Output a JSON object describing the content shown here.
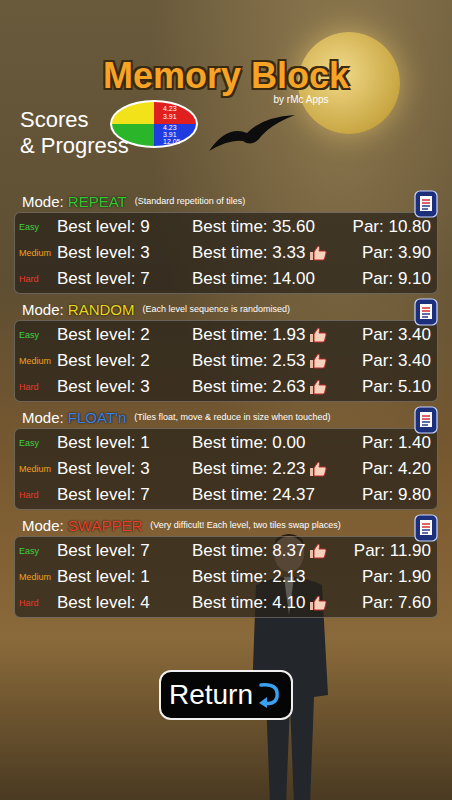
{
  "title": "Memory Block",
  "byline": "by rMc Apps",
  "heading": [
    "Scores",
    "& Progress"
  ],
  "pie": {
    "top": [
      "4.23",
      "3.91"
    ],
    "bottom": [
      "4.23",
      "3.91",
      "12.05"
    ]
  },
  "labels": {
    "mode": "Mode: ",
    "level": "Best level:",
    "time": "Best time:",
    "par": "Par:"
  },
  "modes": [
    {
      "name": "REPEAT",
      "color": "#2fcc2f",
      "description": "(Standard repetition of tiles)",
      "rows": [
        {
          "difficulty": "Easy",
          "color": "#3fd03f",
          "best_level": "9",
          "best_time": "35.60",
          "par": "10.80",
          "beat_par": false
        },
        {
          "difficulty": "Medium",
          "color": "#f0a020",
          "best_level": "3",
          "best_time": "3.33",
          "par": "3.90",
          "beat_par": true
        },
        {
          "difficulty": "Hard",
          "color": "#e83a2a",
          "best_level": "7",
          "best_time": "14.00",
          "par": "9.10",
          "beat_par": false
        }
      ]
    },
    {
      "name": "RANDOM",
      "color": "#ecd81a",
      "description": "(Each level sequence is randomised)",
      "rows": [
        {
          "difficulty": "Easy",
          "color": "#3fd03f",
          "best_level": "2",
          "best_time": "1.93",
          "par": "3.40",
          "beat_par": true
        },
        {
          "difficulty": "Medium",
          "color": "#f0a020",
          "best_level": "2",
          "best_time": "2.53",
          "par": "3.40",
          "beat_par": true
        },
        {
          "difficulty": "Hard",
          "color": "#e83a2a",
          "best_level": "3",
          "best_time": "2.63",
          "par": "5.10",
          "beat_par": true
        }
      ]
    },
    {
      "name": "FLOAT'n",
      "color": "#3a80e8",
      "description": "(Tiles float, move & reduce in size when touched)",
      "rows": [
        {
          "difficulty": "Easy",
          "color": "#3fd03f",
          "best_level": "1",
          "best_time": "0.00",
          "par": "1.40",
          "beat_par": false
        },
        {
          "difficulty": "Medium",
          "color": "#f0a020",
          "best_level": "3",
          "best_time": "2.23",
          "par": "4.20",
          "beat_par": true
        },
        {
          "difficulty": "Hard",
          "color": "#e83a2a",
          "best_level": "7",
          "best_time": "24.37",
          "par": "9.80",
          "beat_par": false
        }
      ]
    },
    {
      "name": "SWAPPER",
      "color": "#e8402a",
      "description": "(Very difficult! Each level, two tiles swap places)",
      "rows": [
        {
          "difficulty": "Easy",
          "color": "#3fd03f",
          "best_level": "7",
          "best_time": "8.37",
          "par": "11.90",
          "beat_par": true
        },
        {
          "difficulty": "Medium",
          "color": "#f0a020",
          "best_level": "1",
          "best_time": "2.13",
          "par": "1.90",
          "beat_par": false
        },
        {
          "difficulty": "Hard",
          "color": "#e83a2a",
          "best_level": "4",
          "best_time": "4.10",
          "par": "7.60",
          "beat_par": true
        }
      ]
    }
  ],
  "return_button": "Return"
}
